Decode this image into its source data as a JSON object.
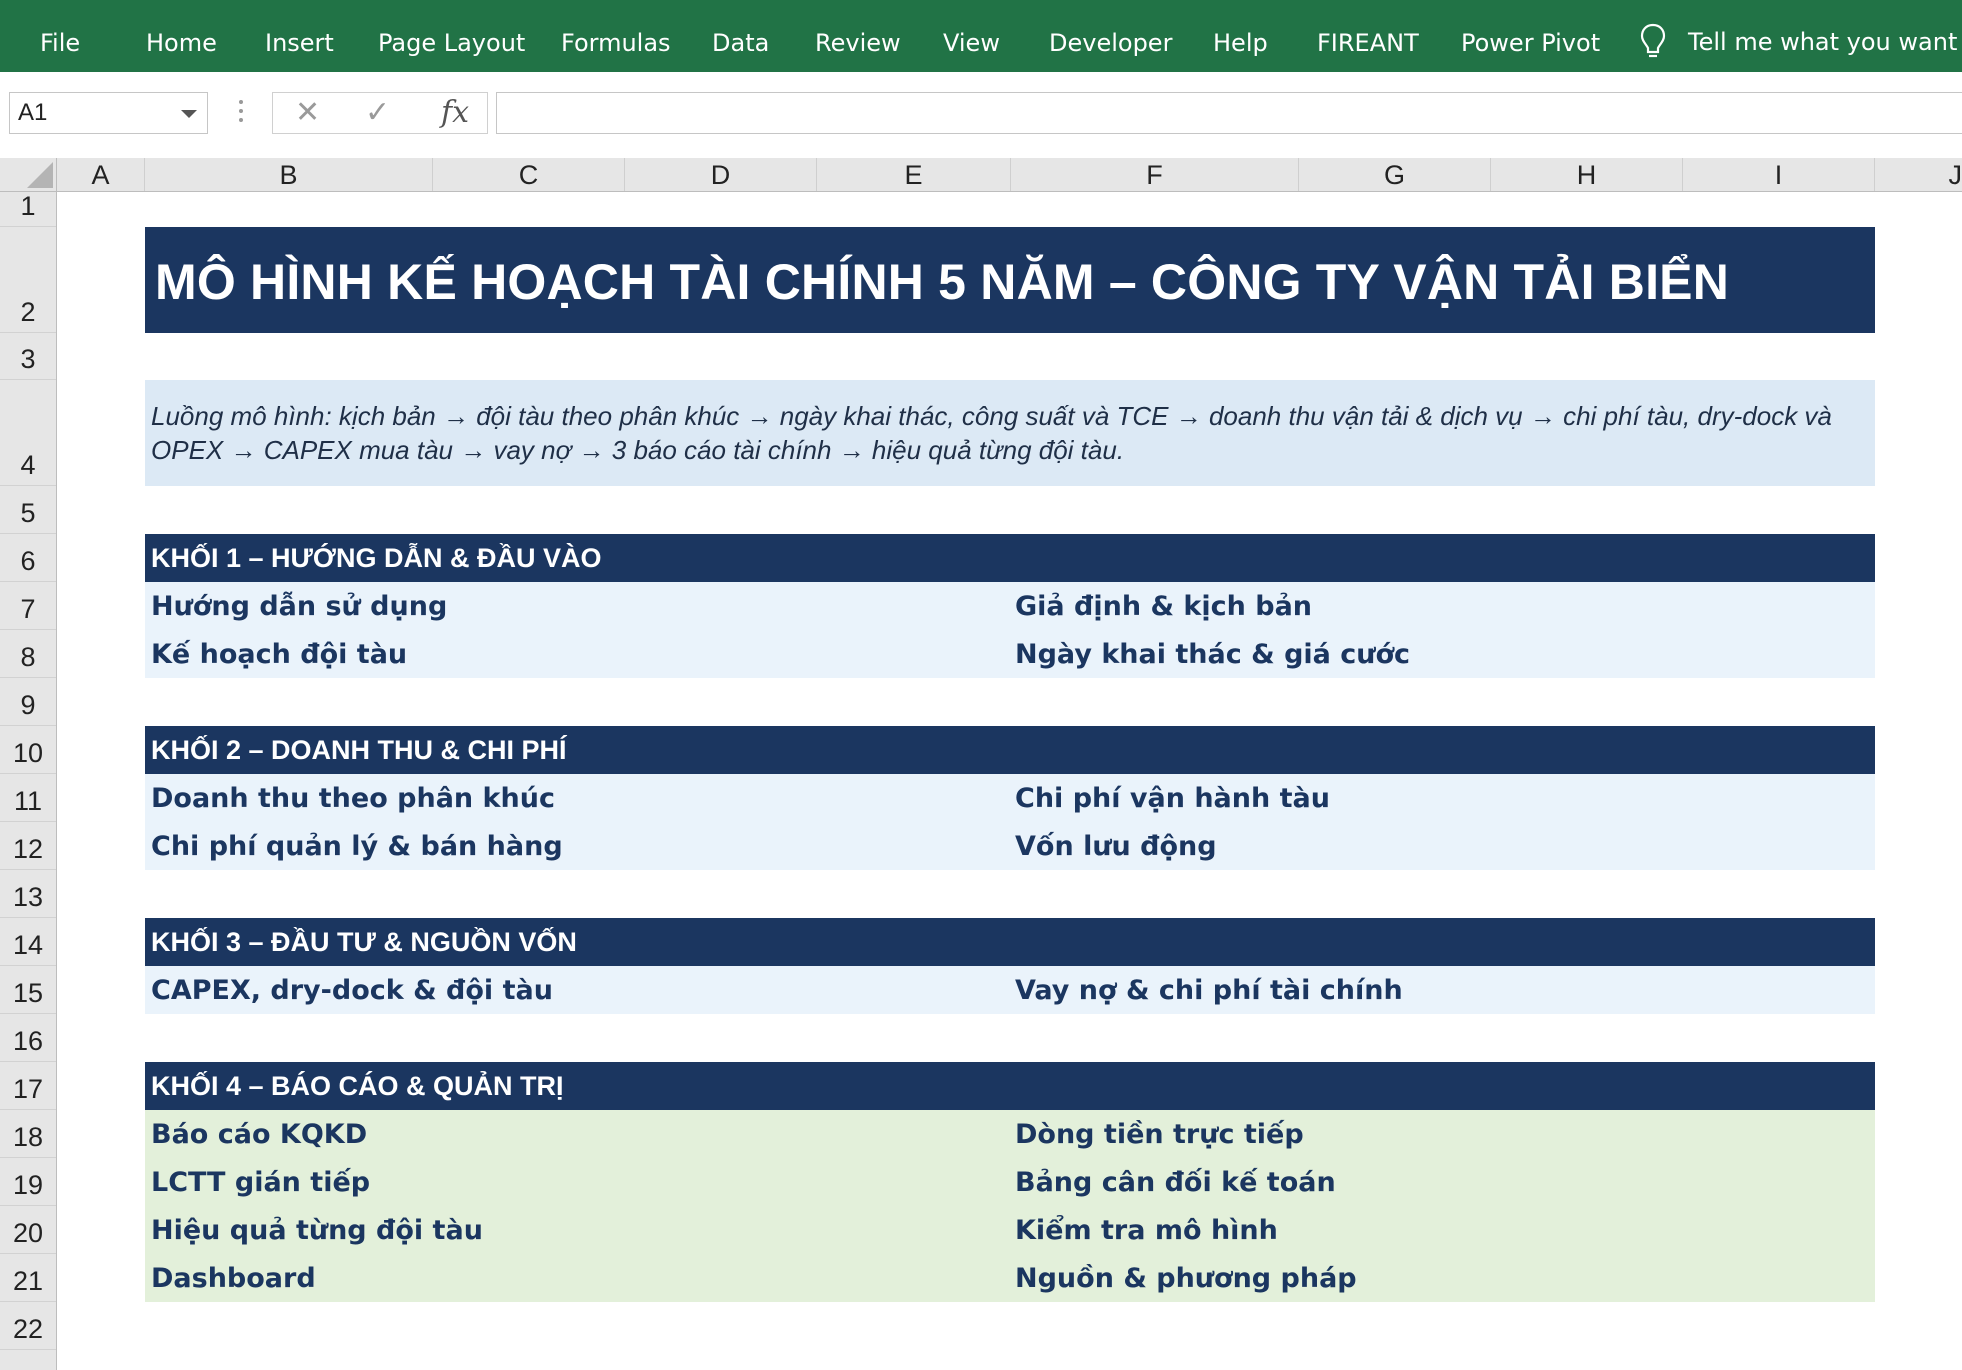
{
  "ribbon": {
    "tabs": [
      "File",
      "Home",
      "Insert",
      "Page Layout",
      "Formulas",
      "Data",
      "Review",
      "View",
      "Developer",
      "Help",
      "FIREANT",
      "Power Pivot"
    ],
    "tell_me": "Tell me what you want to do"
  },
  "formula_bar": {
    "name_box": "A1",
    "fx_label": "fx",
    "formula": ""
  },
  "grid": {
    "columns": [
      "A",
      "B",
      "C",
      "D",
      "E",
      "F",
      "G",
      "H",
      "I",
      "J"
    ],
    "rows": [
      "1",
      "2",
      "3",
      "4",
      "5",
      "6",
      "7",
      "8",
      "9",
      "10",
      "11",
      "12",
      "13",
      "14",
      "15",
      "16",
      "17",
      "18",
      "19",
      "20",
      "21",
      "22"
    ]
  },
  "sheet": {
    "title": "MÔ HÌNH KẾ HOẠCH TÀI CHÍNH 5 NĂM – CÔNG TY VẬN TẢI BIỂN",
    "description": "Luồng mô hình: kịch bản → đội tàu theo phân khúc → ngày khai thác, công suất và TCE → doanh thu vận tải & dịch vụ → chi phí tàu, dry-dock và OPEX → CAPEX mua tàu → vay nợ → 3 báo cáo tài chính → hiệu quả từng đội tàu.",
    "blocks": [
      {
        "title": "KHỐI 1 – HƯỚNG DẪN & ĐẦU VÀO",
        "left": [
          "Hướng dẫn sử dụng",
          "Kế hoạch đội tàu"
        ],
        "right": [
          "Giả định & kịch bản",
          "Ngày khai thác & giá cước"
        ]
      },
      {
        "title": "KHỐI 2 – DOANH THU & CHI PHÍ",
        "left": [
          "Doanh thu theo phân khúc",
          "Chi phí quản lý & bán hàng"
        ],
        "right": [
          "Chi phí vận hành tàu",
          "Vốn lưu động"
        ]
      },
      {
        "title": "KHỐI 3 – ĐẦU TƯ & NGUỒN VỐN",
        "left": [
          "CAPEX, dry-dock & đội tàu"
        ],
        "right": [
          "Vay nợ & chi phí tài chính"
        ]
      },
      {
        "title": "KHỐI 4 – BÁO CÁO & QUẢN TRỊ",
        "left": [
          "Báo cáo KQKD",
          "LCTT gián tiếp",
          "Hiệu quả từng đội tàu",
          "Dashboard"
        ],
        "right": [
          "Dòng tiền trực tiếp",
          "Bảng cân đối kế toán",
          "Kiểm tra mô hình",
          "Nguồn & phương pháp"
        ]
      }
    ]
  },
  "colors": {
    "ribbon": "#217346",
    "header_navy": "#1b3660",
    "desc_bg": "#dce9f5",
    "block_blue_bg": "#eaf3fb",
    "block_green_bg": "#e3f0da"
  },
  "icons": {
    "tell_me": "lightbulb-icon",
    "name_box_dropdown": "chevron-down-icon",
    "cancel": "close-icon",
    "enter": "check-icon"
  }
}
